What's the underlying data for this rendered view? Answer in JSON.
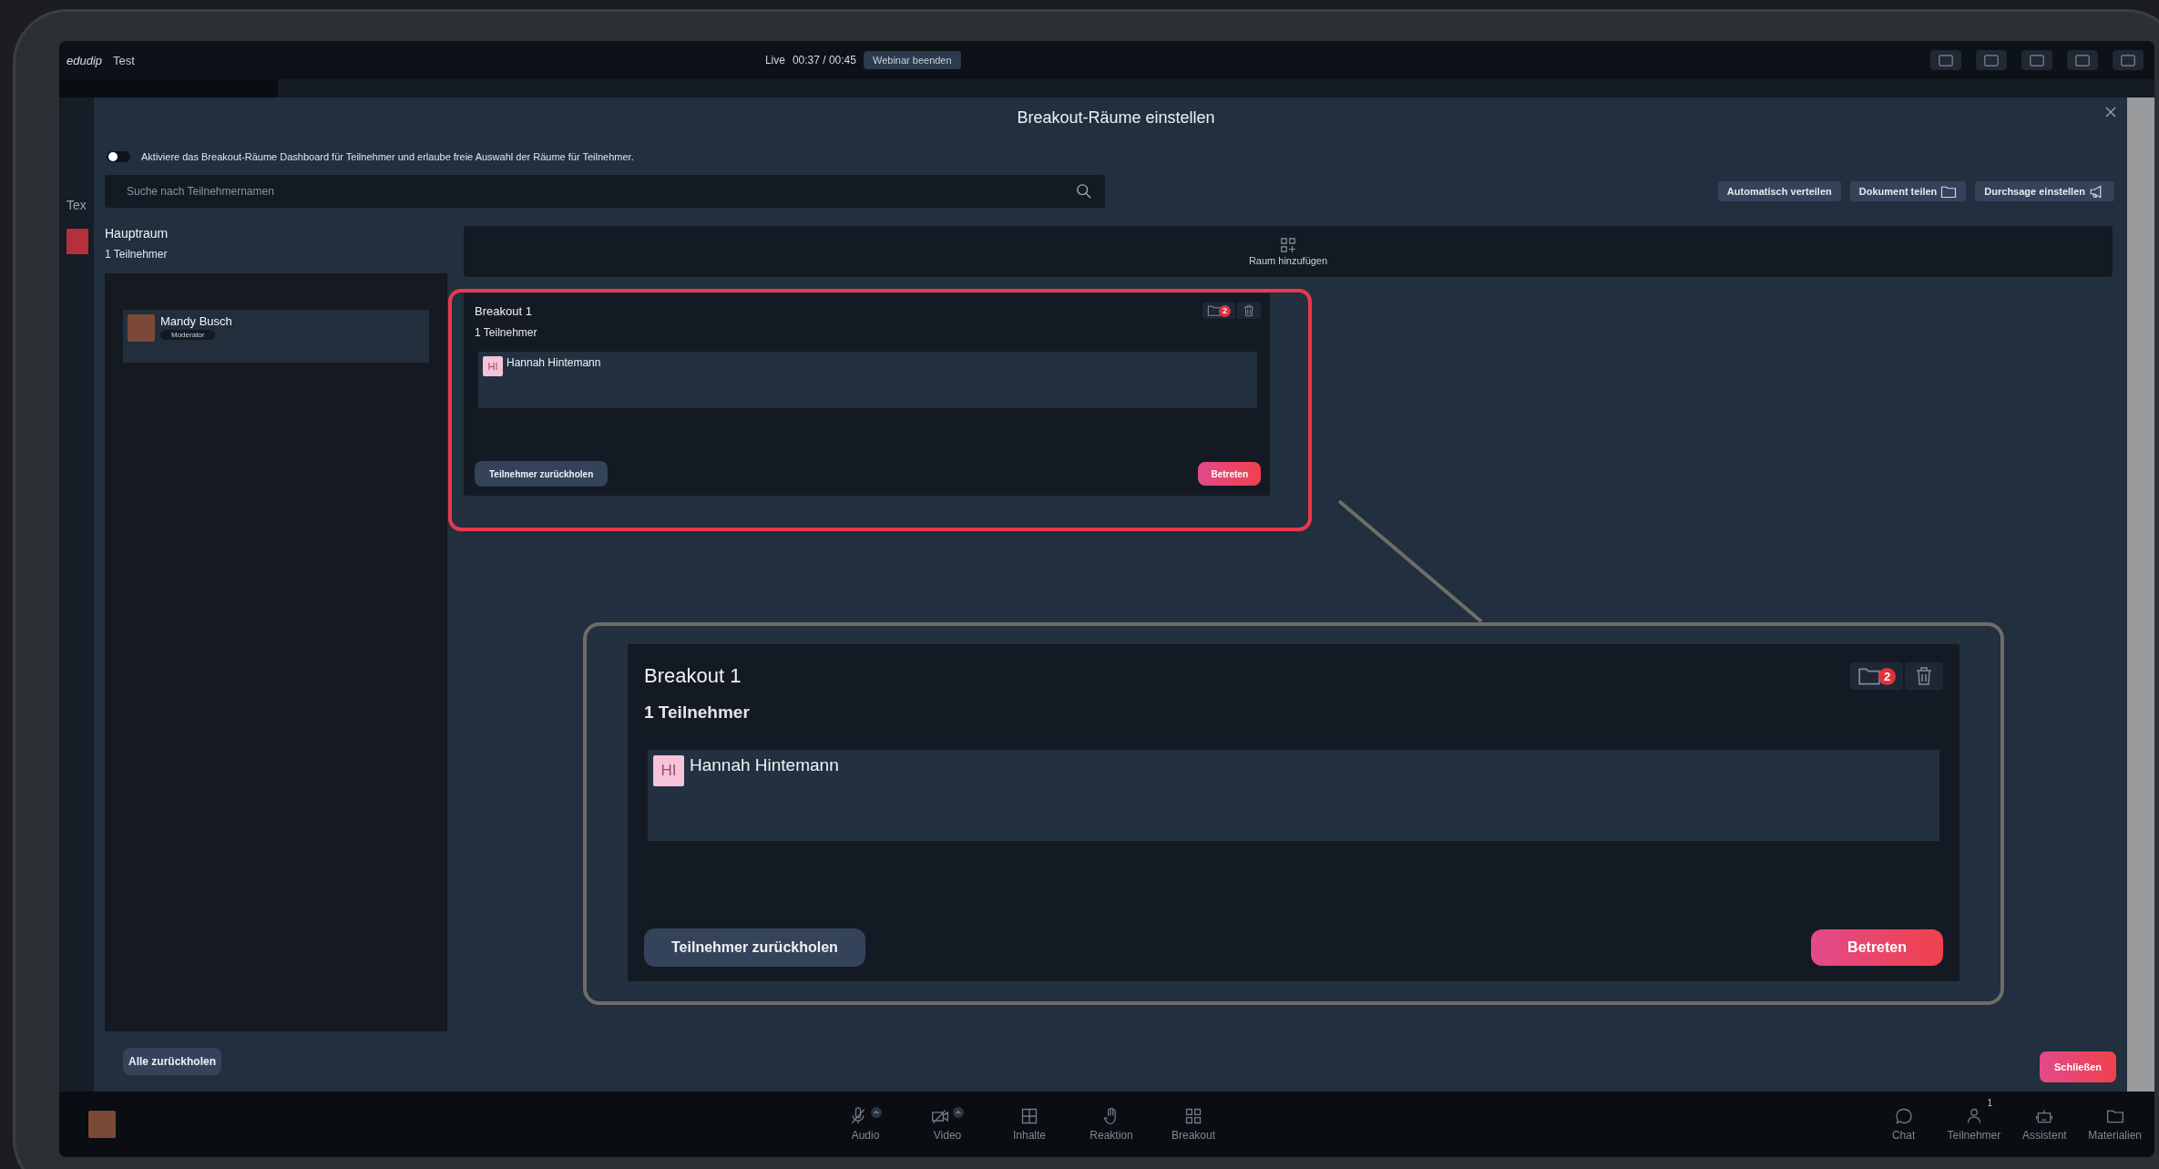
{
  "app": {
    "logo": "edudip",
    "title": "Test",
    "live_label": "Live",
    "time": "00:37 / 00:45",
    "end_button": "Webinar beenden"
  },
  "background_text": "Tex",
  "dialog": {
    "title": "Breakout-Räume einstellen",
    "toggle": {
      "label": "Aktiviere das Breakout-Räume Dashboard für Teilnehmer und erlaube freie Auswahl der Räume für Teilnehmer.",
      "on": false
    },
    "search": {
      "placeholder": "Suche nach Teilnehmernamen"
    },
    "actions": [
      {
        "label": "Automatisch verteilen",
        "kind": "plain"
      },
      {
        "label": "Dokument teilen",
        "kind": "folder"
      },
      {
        "label": "Durchsage einstellen",
        "kind": "megaphone"
      }
    ],
    "main_room": {
      "title": "Hauptraum",
      "count": "1 Teilnehmer",
      "participants": [
        {
          "name": "Mandy Busch",
          "role": "Moderator"
        }
      ]
    },
    "recall_all_button": "Alle zurückholen",
    "add_room": "Raum hinzufügen",
    "rooms": [
      {
        "title": "Breakout 1",
        "count": "1 Teilnehmer",
        "doc_badge": "2",
        "participants": [
          {
            "name": "Hannah Hintemann",
            "initials": "HI"
          }
        ],
        "recall_button": "Teilnehmer zurückholen",
        "join_button": "Betreten"
      }
    ],
    "close_button": "Schließen"
  },
  "callout": {
    "title": "Breakout 1",
    "count": "1 Teilnehmer",
    "doc_badge": "2",
    "participants": [
      {
        "name": "Hannah Hintemann",
        "initials": "HI"
      }
    ],
    "recall_button": "Teilnehmer zurückholen",
    "join_button": "Betreten"
  },
  "bottom_bar": {
    "center": [
      {
        "label": "Audio",
        "kind": "mic-off",
        "has_menu": true
      },
      {
        "label": "Video",
        "kind": "camera-off",
        "has_menu": true
      },
      {
        "label": "Inhalte",
        "kind": "layout",
        "has_menu": false
      },
      {
        "label": "Reaktion",
        "kind": "hand",
        "has_menu": false
      },
      {
        "label": "Breakout",
        "kind": "grid",
        "has_menu": false
      }
    ],
    "right": [
      {
        "label": "Chat",
        "kind": "chat"
      },
      {
        "label": "Teilnehmer",
        "kind": "person",
        "badge": "1"
      },
      {
        "label": "Assistent",
        "kind": "robot"
      },
      {
        "label": "Materialien",
        "kind": "folder"
      }
    ]
  }
}
